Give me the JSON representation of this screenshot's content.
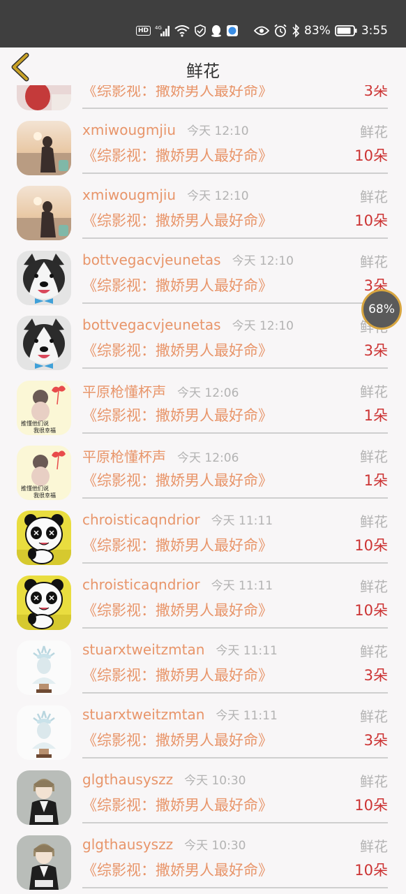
{
  "status_bar": {
    "network": "4G",
    "battery_percent": "83%",
    "time": "3:55"
  },
  "nav": {
    "title": "鲜花"
  },
  "partial_row": {
    "book_title": "《综影视：撒娇男人最好命》",
    "count": "3朵"
  },
  "rows": [
    {
      "username": "xmiwougmjiu",
      "time": "今天 12:10",
      "gift": "鲜花",
      "book_title": "《综影视：撒娇男人最好命》",
      "count": "10朵",
      "avatar": "girl-sunset"
    },
    {
      "username": "xmiwougmjiu",
      "time": "今天 12:10",
      "gift": "鲜花",
      "book_title": "《综影视：撒娇男人最好命》",
      "count": "10朵",
      "avatar": "girl-sunset"
    },
    {
      "username": "bottvegacvjeunetas",
      "time": "今天 12:10",
      "gift": "鲜花",
      "book_title": "《综影视：撒娇男人最好命》",
      "count": "3朵",
      "avatar": "husky-dog"
    },
    {
      "username": "bottvegacvjeunetas",
      "time": "今天 12:10",
      "gift": "鲜花",
      "book_title": "《综影视：撒娇男人最好命》",
      "count": "3朵",
      "avatar": "husky-dog"
    },
    {
      "username": "平原枪懂杯声",
      "time": "今天 12:06",
      "gift": "鲜花",
      "book_title": "《综影视：撒娇男人最好命》",
      "count": "1朵",
      "avatar": "girl-bow"
    },
    {
      "username": "平原枪懂杯声",
      "time": "今天 12:06",
      "gift": "鲜花",
      "book_title": "《综影视：撒娇男人最好命》",
      "count": "1朵",
      "avatar": "girl-bow"
    },
    {
      "username": "chroisticaqndrior",
      "time": "今天 11:11",
      "gift": "鲜花",
      "book_title": "《综影视：撒娇男人最好命》",
      "count": "10朵",
      "avatar": "panda"
    },
    {
      "username": "chroisticaqndrior",
      "time": "今天 11:11",
      "gift": "鲜花",
      "book_title": "《综影视：撒娇男人最好命》",
      "count": "10朵",
      "avatar": "panda"
    },
    {
      "username": "stuarxtweitzmtan",
      "time": "今天 11:11",
      "gift": "鲜花",
      "book_title": "《综影视：撒娇男人最好命》",
      "count": "3朵",
      "avatar": "liberty-bust"
    },
    {
      "username": "stuarxtweitzmtan",
      "time": "今天 11:11",
      "gift": "鲜花",
      "book_title": "《综影视：撒娇男人最好命》",
      "count": "3朵",
      "avatar": "liberty-bust"
    },
    {
      "username": "glgthausyszz",
      "time": "今天 10:30",
      "gift": "鲜花",
      "book_title": "《综影视：撒娇男人最好命》",
      "count": "10朵",
      "avatar": "anime-boy"
    },
    {
      "username": "glgthausyszz",
      "time": "今天 10:30",
      "gift": "鲜花",
      "book_title": "《综影视：撒娇男人最好命》",
      "count": "10朵",
      "avatar": "anime-boy"
    }
  ],
  "floating_widget": {
    "value": "68%"
  },
  "colors": {
    "username": "#e8956a",
    "count": "#cc3333",
    "muted": "#b3b3b3",
    "status_bar_bg": "#3f3f3f",
    "back_arrow": "#c9a227"
  }
}
